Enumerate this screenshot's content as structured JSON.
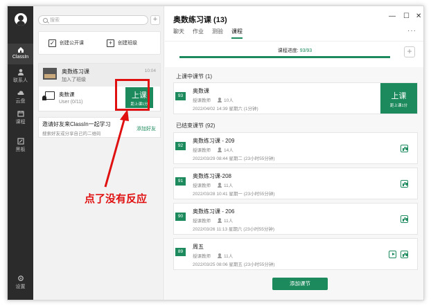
{
  "nav": {
    "items": [
      {
        "label": "ClassIn",
        "icon": "home-icon"
      },
      {
        "label": "联系人",
        "icon": "contacts-icon"
      },
      {
        "label": "云盘",
        "icon": "cloud-icon"
      },
      {
        "label": "课程",
        "icon": "course-icon"
      },
      {
        "label": "黑板",
        "icon": "blackboard-icon"
      }
    ],
    "settings": "设置"
  },
  "search": {
    "placeholder": "搜索"
  },
  "quick": {
    "open_class": "创建公开课",
    "create_class": "创建班级"
  },
  "class_card": {
    "title": "奥数练习课",
    "subtitle": "加入了班级",
    "time": "10:04",
    "lesson_title": "奥数课",
    "lesson_sub": "User (0/11)",
    "up_label": "上课",
    "up_sub": "距上课1分"
  },
  "invite": {
    "title": "邀请好友来ClassIn一起学习",
    "subtitle": "搜索好友或分享自己的二维码",
    "link": "添加好友"
  },
  "annotation": "点了没有反应",
  "right": {
    "title": "奥数练习课 (13)",
    "tabs": [
      "聊天",
      "作业",
      "测验",
      "课程"
    ],
    "progress_label": "课程进度:",
    "progress_value": "93/93",
    "progress": 1.0,
    "upcoming_label": "上课中课节 (1)",
    "ended_label": "已结束课节 (92)",
    "add_lesson": "添加课节"
  },
  "upcoming": {
    "badge": "93",
    "title": "奥数课",
    "teacher": "授课教师",
    "count": "10人",
    "date": "2022/04/02 14:39 星期六 (1分钟)",
    "up_label": "上课",
    "up_sub": "距上课1分"
  },
  "ended": [
    {
      "badge": "92",
      "title": "奥数练习课 - 209",
      "teacher": "授课教师",
      "count": "14人",
      "date": "2022/03/29 08:44 星期二 (23小时55分钟)"
    },
    {
      "badge": "91",
      "title": "奥数练习课-208",
      "teacher": "授课教师",
      "count": "11人",
      "date": "2022/03/28 10:41 星期一 (23小时55分钟)"
    },
    {
      "badge": "90",
      "title": "奥数练习课 - 206",
      "teacher": "授课教师",
      "count": "11人",
      "date": "2022/03/26 11:13 星期六 (23小时55分钟)"
    },
    {
      "badge": "89",
      "title": "周五",
      "teacher": "授课教师",
      "count": "11人",
      "date": "2022/03/25 08:06 星期五 (23小时55分钟)"
    }
  ],
  "colors": {
    "accent": "#1c8a5c",
    "annotation": "#e01010",
    "nav_bg": "#2b2b2b"
  }
}
